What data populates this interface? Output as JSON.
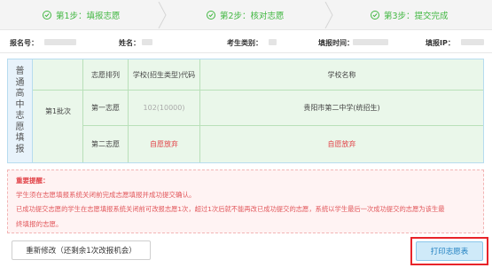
{
  "steps": [
    {
      "label": "第1步：填报志愿"
    },
    {
      "label": "第2步：核对志愿"
    },
    {
      "label": "第3步：提交完成"
    }
  ],
  "info": {
    "exam_no_label": "报名号：",
    "name_label": "姓名：",
    "category_label": "考生类别：",
    "time_label": "填报时间：",
    "ip_label": "填报IP："
  },
  "table": {
    "vertical_title": [
      "普",
      "通",
      "高",
      "中",
      "志",
      "愿",
      "填",
      "报"
    ],
    "batch": "第1批次",
    "headers": {
      "rank": "志愿排列",
      "type_code": "学校(招生类型)代码",
      "name": "学校名称"
    },
    "rows": [
      {
        "rank": "第一志愿",
        "code": "102(10000)",
        "name": "贵阳市第二中学(统招生)"
      },
      {
        "rank": "第二志愿",
        "code": "自愿放弃",
        "name": "自愿放弃"
      }
    ]
  },
  "notice": {
    "title": "重要提醒：",
    "lines": [
      "学生须在志愿填报系统关闭前完成志愿填报并成功提交确认。",
      "已成功提交志愿的学生在志愿填报系统关闭前可改报志愿1次，超过1次后就不能再改已成功提交的志愿，系统以学生最后一次成功提交的志愿为该生最",
      "终填报的志愿。"
    ]
  },
  "buttons": {
    "redo": "重新修改（还剩余1次改报机会）",
    "print": "打印志愿表"
  },
  "colors": {
    "accent_green": "#42b742",
    "alert_red": "#e2454a",
    "highlight_border": "#e8242a"
  }
}
